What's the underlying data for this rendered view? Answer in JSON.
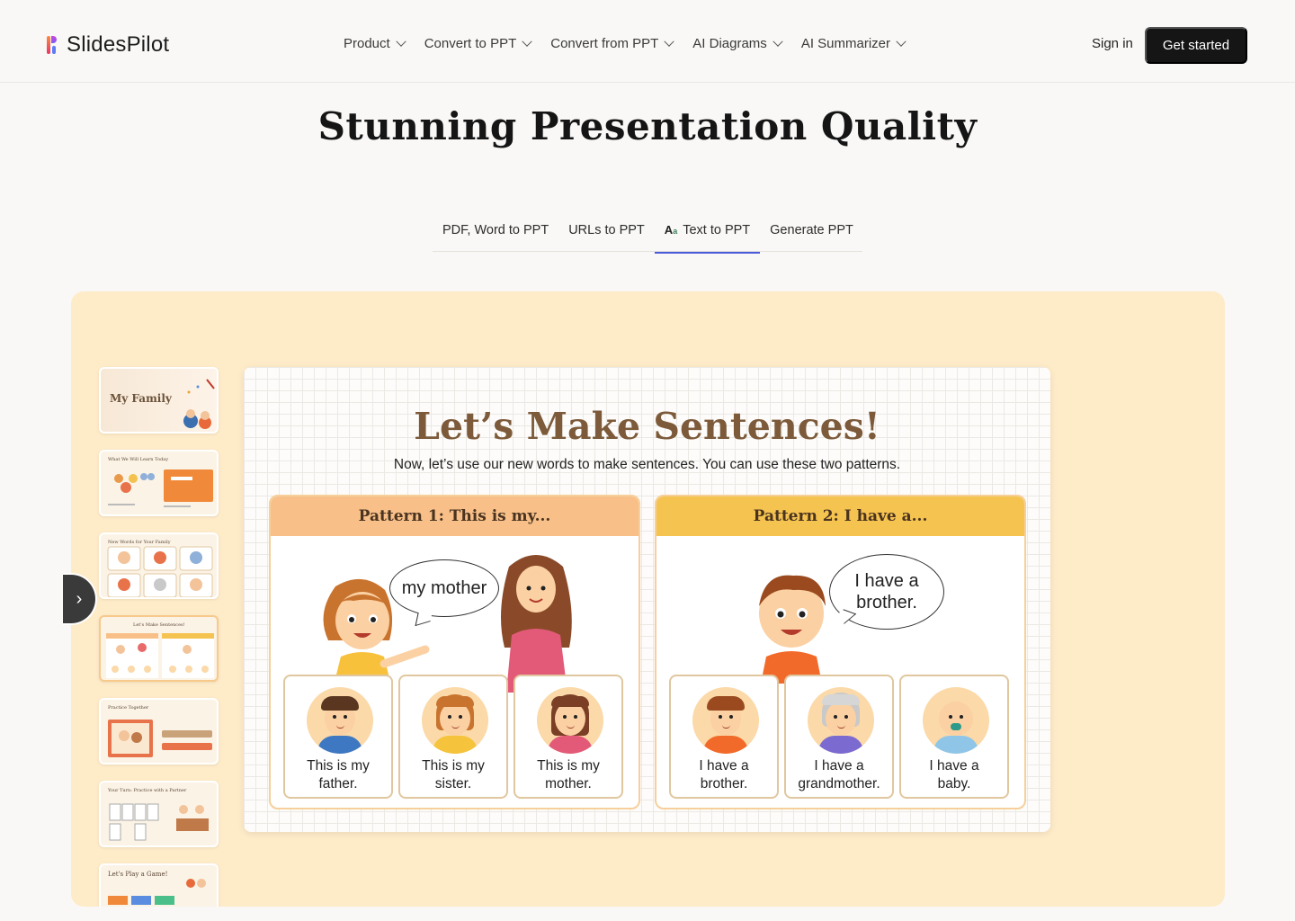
{
  "brand": {
    "name": "SlidesPilot"
  },
  "nav": {
    "items": [
      "Product",
      "Convert to PPT",
      "Convert from PPT",
      "AI Diagrams",
      "AI Summarizer"
    ]
  },
  "auth": {
    "signin": "Sign in",
    "cta": "Get started"
  },
  "hero": {
    "title": "Stunning Presentation Quality"
  },
  "tabs": {
    "items": [
      "PDF, Word to PPT",
      "URLs to PPT",
      "Text to PPT",
      "Generate PPT"
    ],
    "active": "Text to PPT",
    "active_icon": "Aa"
  },
  "thumbnails": [
    {
      "title": "My Family"
    },
    {
      "title": "What We Will Learn Today"
    },
    {
      "title": "New Words for Your Family"
    },
    {
      "title": "Let's Make Sentences!"
    },
    {
      "title": "Practice Together"
    },
    {
      "title": "Your Turn: Practice with a Partner"
    },
    {
      "title": "Let's Play a Game!"
    }
  ],
  "slide": {
    "title": "Let’s Make Sentences!",
    "subtitle": "Now, let’s use our new words to make sentences. You can use these two patterns.",
    "pattern1": {
      "heading": "Pattern 1: This is my...",
      "bubble": "my mother",
      "cards": [
        {
          "line1": "This is my",
          "line2": "father."
        },
        {
          "line1": "This is my",
          "line2": "sister."
        },
        {
          "line1": "This is my",
          "line2": "mother."
        }
      ]
    },
    "pattern2": {
      "heading": "Pattern 2: I have a...",
      "bubble_line1": "I have a",
      "bubble_line2": "brother.",
      "cards": [
        {
          "line1": "I have a",
          "line2": "brother."
        },
        {
          "line1": "I have a",
          "line2": "grandmother."
        },
        {
          "line1": "I have a",
          "line2": "baby."
        }
      ]
    }
  },
  "colors": {
    "stage_bg": "#feebc8",
    "cta_bg": "#151515",
    "tab_active": "#4a5bdc",
    "slide_title": "#7c5a3a"
  }
}
